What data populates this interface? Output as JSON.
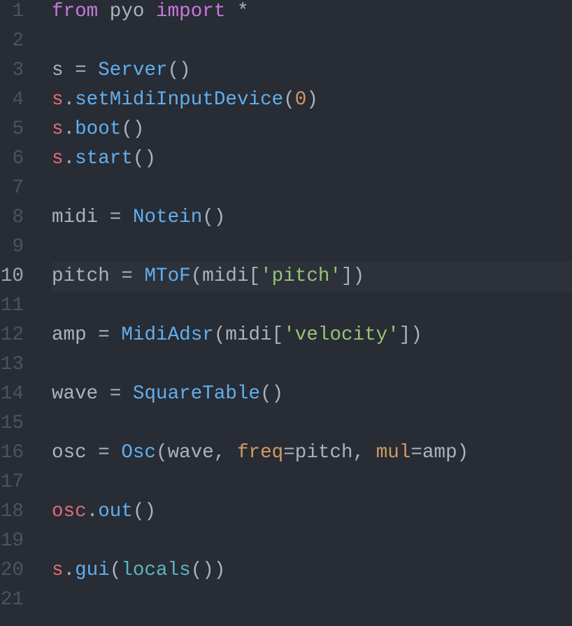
{
  "editor": {
    "active_line": 10,
    "colors": {
      "background": "#282c34",
      "keyword": "#c678dd",
      "function": "#61afef",
      "variable": "#e06c75",
      "number": "#d19a66",
      "string": "#98c379",
      "builtin": "#56b6c2"
    },
    "lines": [
      {
        "n": "1",
        "tokens": [
          [
            "kw",
            "from"
          ],
          [
            "txt",
            " pyo "
          ],
          [
            "kw",
            "import"
          ],
          [
            "txt",
            " *"
          ]
        ]
      },
      {
        "n": "2",
        "tokens": []
      },
      {
        "n": "3",
        "tokens": [
          [
            "txt",
            "s = "
          ],
          [
            "fn",
            "Server"
          ],
          [
            "txt",
            "()"
          ]
        ]
      },
      {
        "n": "4",
        "tokens": [
          [
            "var",
            "s"
          ],
          [
            "txt",
            "."
          ],
          [
            "fn",
            "setMidiInputDevice"
          ],
          [
            "txt",
            "("
          ],
          [
            "num",
            "0"
          ],
          [
            "txt",
            ")"
          ]
        ]
      },
      {
        "n": "5",
        "tokens": [
          [
            "var",
            "s"
          ],
          [
            "txt",
            "."
          ],
          [
            "fn",
            "boot"
          ],
          [
            "txt",
            "()"
          ]
        ]
      },
      {
        "n": "6",
        "tokens": [
          [
            "var",
            "s"
          ],
          [
            "txt",
            "."
          ],
          [
            "fn",
            "start"
          ],
          [
            "txt",
            "()"
          ]
        ]
      },
      {
        "n": "7",
        "tokens": []
      },
      {
        "n": "8",
        "tokens": [
          [
            "txt",
            "midi = "
          ],
          [
            "fn",
            "Notein"
          ],
          [
            "txt",
            "()"
          ]
        ]
      },
      {
        "n": "9",
        "tokens": []
      },
      {
        "n": "10",
        "tokens": [
          [
            "txt",
            "pitch = "
          ],
          [
            "fn",
            "MToF"
          ],
          [
            "txt",
            "(midi["
          ],
          [
            "str",
            "'pitch'"
          ],
          [
            "txt",
            "])"
          ]
        ]
      },
      {
        "n": "11",
        "tokens": []
      },
      {
        "n": "12",
        "tokens": [
          [
            "txt",
            "amp = "
          ],
          [
            "fn",
            "MidiAdsr"
          ],
          [
            "txt",
            "(midi["
          ],
          [
            "str",
            "'velocity'"
          ],
          [
            "txt",
            "])"
          ]
        ]
      },
      {
        "n": "13",
        "tokens": []
      },
      {
        "n": "14",
        "tokens": [
          [
            "txt",
            "wave = "
          ],
          [
            "fn",
            "SquareTable"
          ],
          [
            "txt",
            "()"
          ]
        ]
      },
      {
        "n": "15",
        "tokens": []
      },
      {
        "n": "16",
        "tokens": [
          [
            "txt",
            "osc = "
          ],
          [
            "fn",
            "Osc"
          ],
          [
            "txt",
            "(wave, "
          ],
          [
            "param",
            "freq"
          ],
          [
            "txt",
            "=pitch, "
          ],
          [
            "param",
            "mul"
          ],
          [
            "txt",
            "=amp)"
          ]
        ]
      },
      {
        "n": "17",
        "tokens": []
      },
      {
        "n": "18",
        "tokens": [
          [
            "var",
            "osc"
          ],
          [
            "txt",
            "."
          ],
          [
            "fn",
            "out"
          ],
          [
            "txt",
            "()"
          ]
        ]
      },
      {
        "n": "19",
        "tokens": []
      },
      {
        "n": "20",
        "tokens": [
          [
            "var",
            "s"
          ],
          [
            "txt",
            "."
          ],
          [
            "fn",
            "gui"
          ],
          [
            "txt",
            "("
          ],
          [
            "builtin",
            "locals"
          ],
          [
            "txt",
            "())"
          ]
        ]
      },
      {
        "n": "21",
        "tokens": []
      }
    ]
  }
}
